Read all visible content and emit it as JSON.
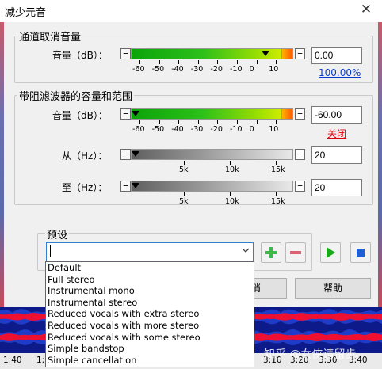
{
  "window": {
    "title": "减少元音",
    "close_glyph": "✕"
  },
  "channel_group": {
    "title": "通道取消音量",
    "volume_label": "音量（dB）：",
    "minus_label": "−",
    "plus_label": "+",
    "value": "0.00",
    "percent_link": "100.00%",
    "ticks": [
      "-60",
      "-50",
      "-40",
      "-30",
      "-20",
      "-10",
      "0",
      "10"
    ]
  },
  "band_group": {
    "title": "带阻滤波器的容量和范围",
    "volume_label": "音量（dB）：",
    "volume_value": "-60.00",
    "off_link": "关闭",
    "ticks": [
      "-60",
      "-50",
      "-40",
      "-30",
      "-20",
      "-10",
      "0",
      "10"
    ],
    "from_label": "从（Hz）：",
    "from_value": "20",
    "to_label": "至（Hz）：",
    "to_value": "20",
    "freq_ticks": [
      "5k",
      "10k",
      "15k"
    ]
  },
  "presets": {
    "title": "预设",
    "combo_value": "",
    "options": [
      "Default",
      "Full stereo",
      "Instrumental mono",
      "Instrumental stereo",
      "Reduced vocals with extra stereo",
      "Reduced vocals with more stereo",
      "Reduced vocals with some stereo",
      "Simple bandstop",
      "Simple cancellation"
    ]
  },
  "buttons": {
    "cancel_fragment": "消",
    "help": "帮助"
  },
  "timeline": {
    "labels": [
      "1:40",
      "1:50",
      "2:00",
      "3:10",
      "3:20",
      "3:30",
      "3:40"
    ]
  },
  "watermark": "知乎 @女侠请留步",
  "colors": {
    "link_blue": "#0a3ccc",
    "off_red": "#e0000a",
    "wave_red": "#ee1030",
    "wave_bg": "#0d1a8a",
    "play_green": "#18a818",
    "stop_blue": "#1f5fd6"
  },
  "icons": [
    "close-icon",
    "thumb-icon",
    "chevron-down-icon",
    "add-icon",
    "remove-icon",
    "play-icon",
    "stop-icon"
  ]
}
